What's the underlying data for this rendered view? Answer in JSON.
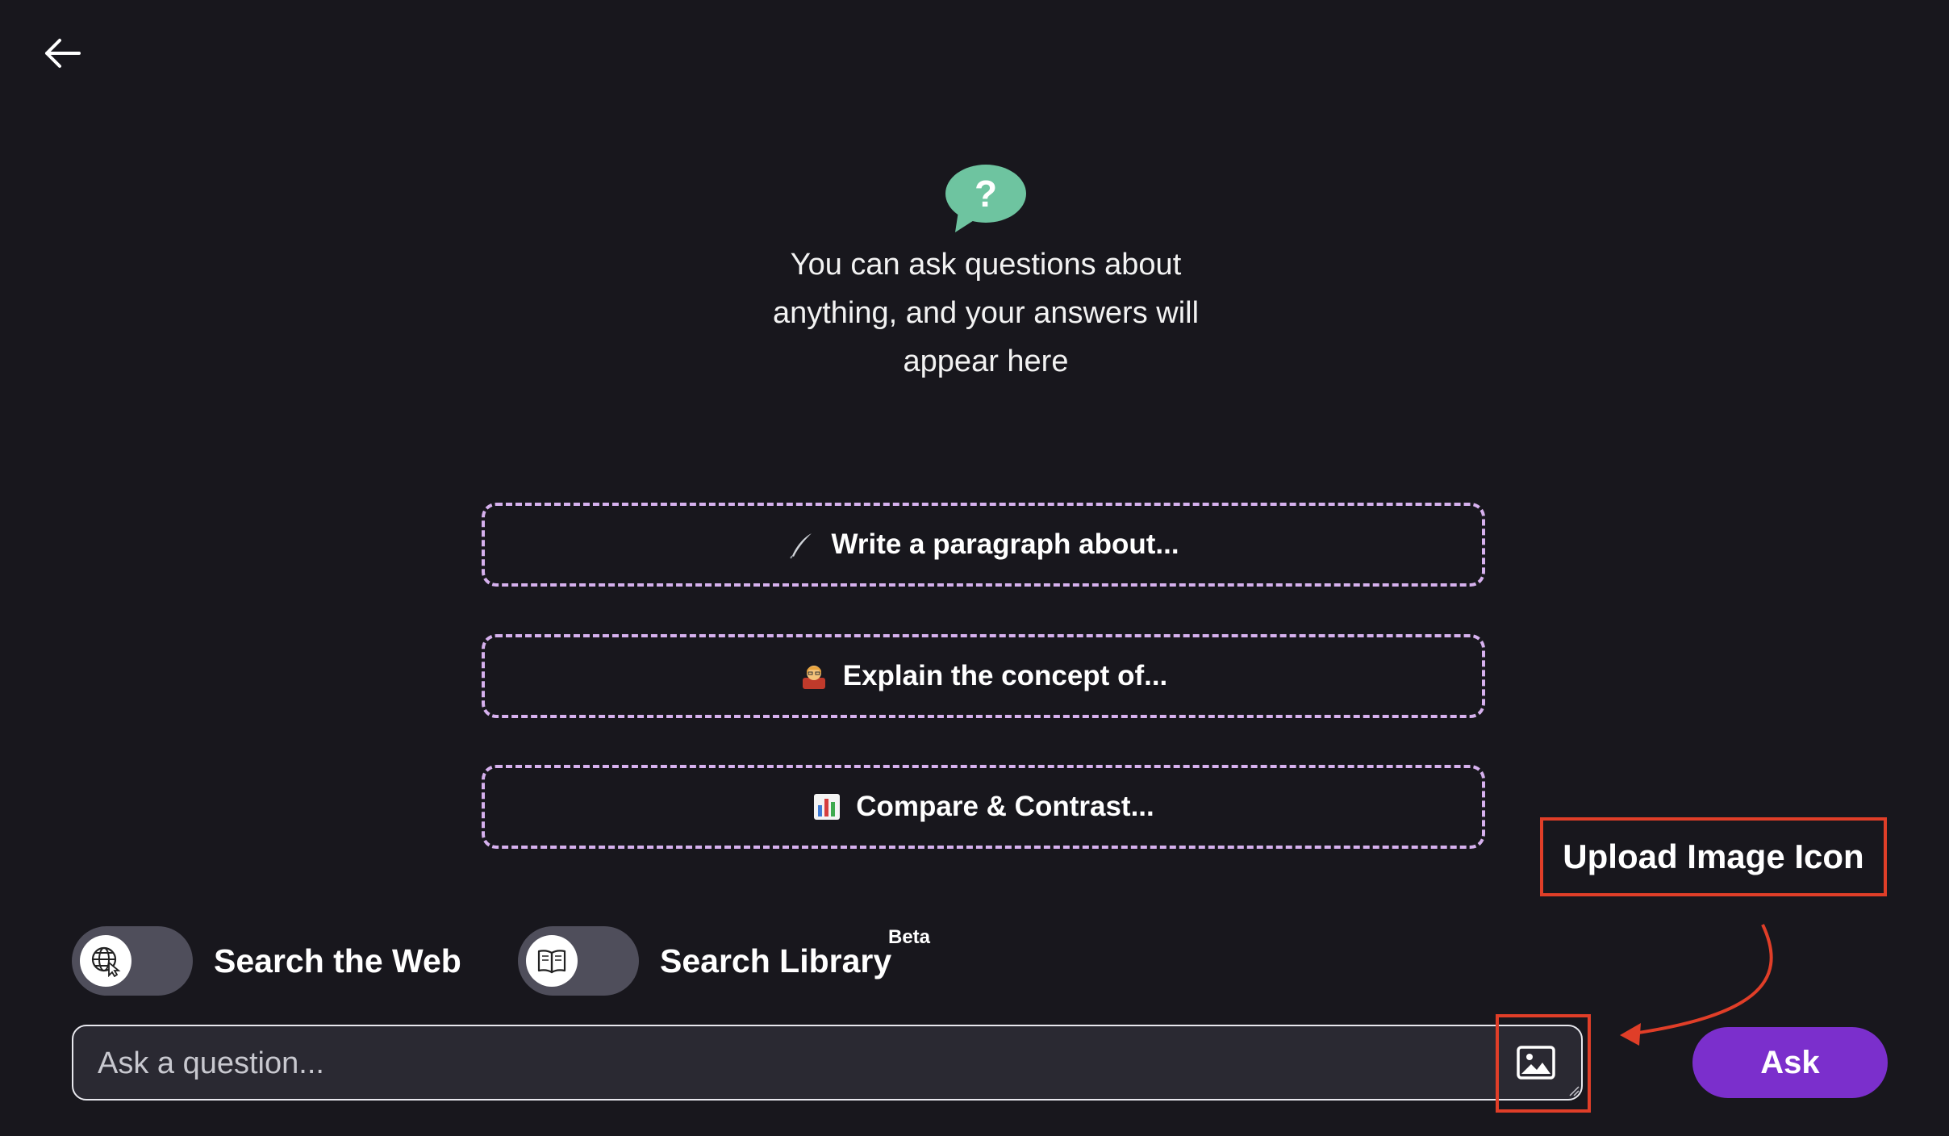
{
  "empty_state": {
    "message": "You can ask questions about anything, and your answers will appear here",
    "icon": "question-bubble-icon"
  },
  "prompts": [
    {
      "label": "Write a paragraph about...",
      "icon": "quill-pen-icon"
    },
    {
      "label": "Explain the concept of...",
      "icon": "teacher-icon"
    },
    {
      "label": "Compare & Contrast...",
      "icon": "bar-chart-icon"
    }
  ],
  "toggles": {
    "web": {
      "label": "Search the Web",
      "icon": "globe-cursor-icon",
      "on": false
    },
    "library": {
      "label": "Search Library",
      "badge": "Beta",
      "icon": "book-icon",
      "on": false
    }
  },
  "ask": {
    "placeholder": "Ask a question...",
    "button_label": "Ask"
  },
  "annotation": {
    "label": "Upload Image Icon"
  },
  "colors": {
    "background": "#18171d",
    "accent": "#7b2fcc",
    "prompt_border": "#d6b1ee",
    "annotation": "#e03e28",
    "bubble": "#6ec4a0"
  }
}
